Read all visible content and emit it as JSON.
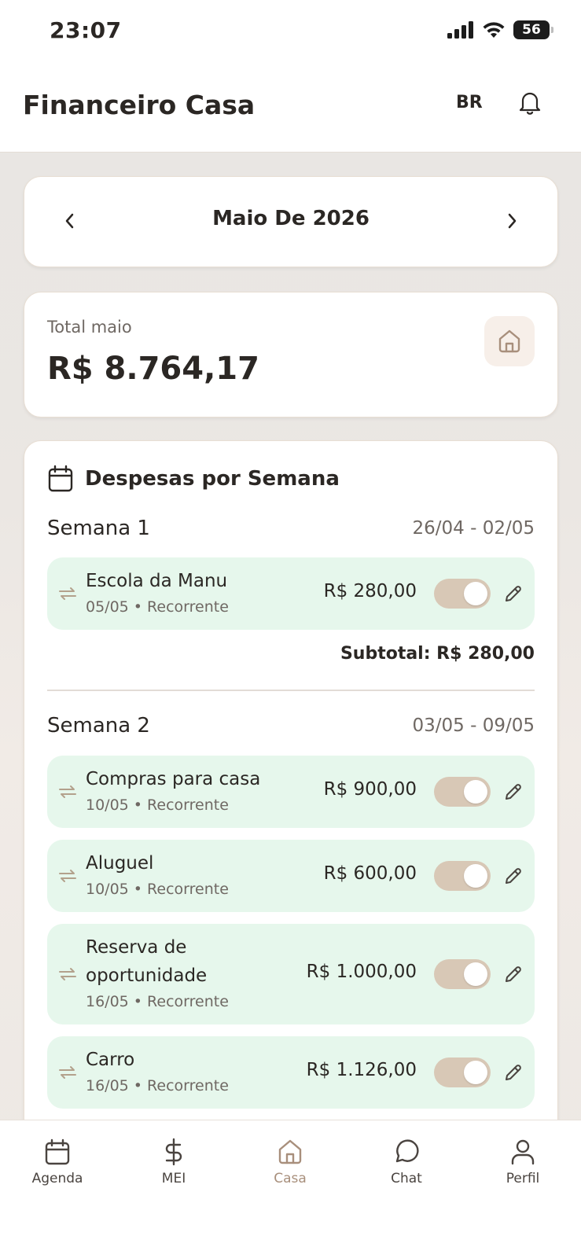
{
  "status_bar": {
    "time": "23:07",
    "battery": "56"
  },
  "header": {
    "title": "Financeiro Casa",
    "lang": "BR"
  },
  "month_selector": {
    "label": "Maio De 2026"
  },
  "total": {
    "label": "Total maio",
    "value": "R$ 8.764,17"
  },
  "weeks": {
    "title": "Despesas por Semana",
    "week1": {
      "title": "Semana 1",
      "range": "26/04 - 02/05",
      "subtotal": "Subtotal: R$ 280,00",
      "items": [
        {
          "name": "Escola da Manu",
          "meta": "05/05 • Recorrente",
          "amount": "R$ 280,00",
          "enabled": true
        }
      ]
    },
    "week2": {
      "title": "Semana 2",
      "range": "03/05 - 09/05",
      "items": [
        {
          "name": "Compras para casa",
          "meta": "10/05 • Recorrente",
          "amount": "R$ 900,00",
          "enabled": true
        },
        {
          "name": "Aluguel",
          "meta": "10/05 • Recorrente",
          "amount": "R$ 600,00",
          "enabled": true
        },
        {
          "name_line1": "Reserva de",
          "name_line2": "oportunidade",
          "meta": "16/05 • Recorrente",
          "amount": "R$ 1.000,00",
          "enabled": true
        },
        {
          "name": "Carro",
          "meta": "16/05 • Recorrente",
          "amount": "R$ 1.126,00",
          "enabled": true
        }
      ]
    }
  },
  "nav": {
    "agenda": "Agenda",
    "mei": "MEI",
    "casa": "Casa",
    "chat": "Chat",
    "perfil": "Perfil",
    "active": "casa"
  },
  "colors": {
    "accent": "#a88f7c",
    "expense_bg": "#e6f7ec",
    "toggle_on": "#d8c8b6"
  }
}
